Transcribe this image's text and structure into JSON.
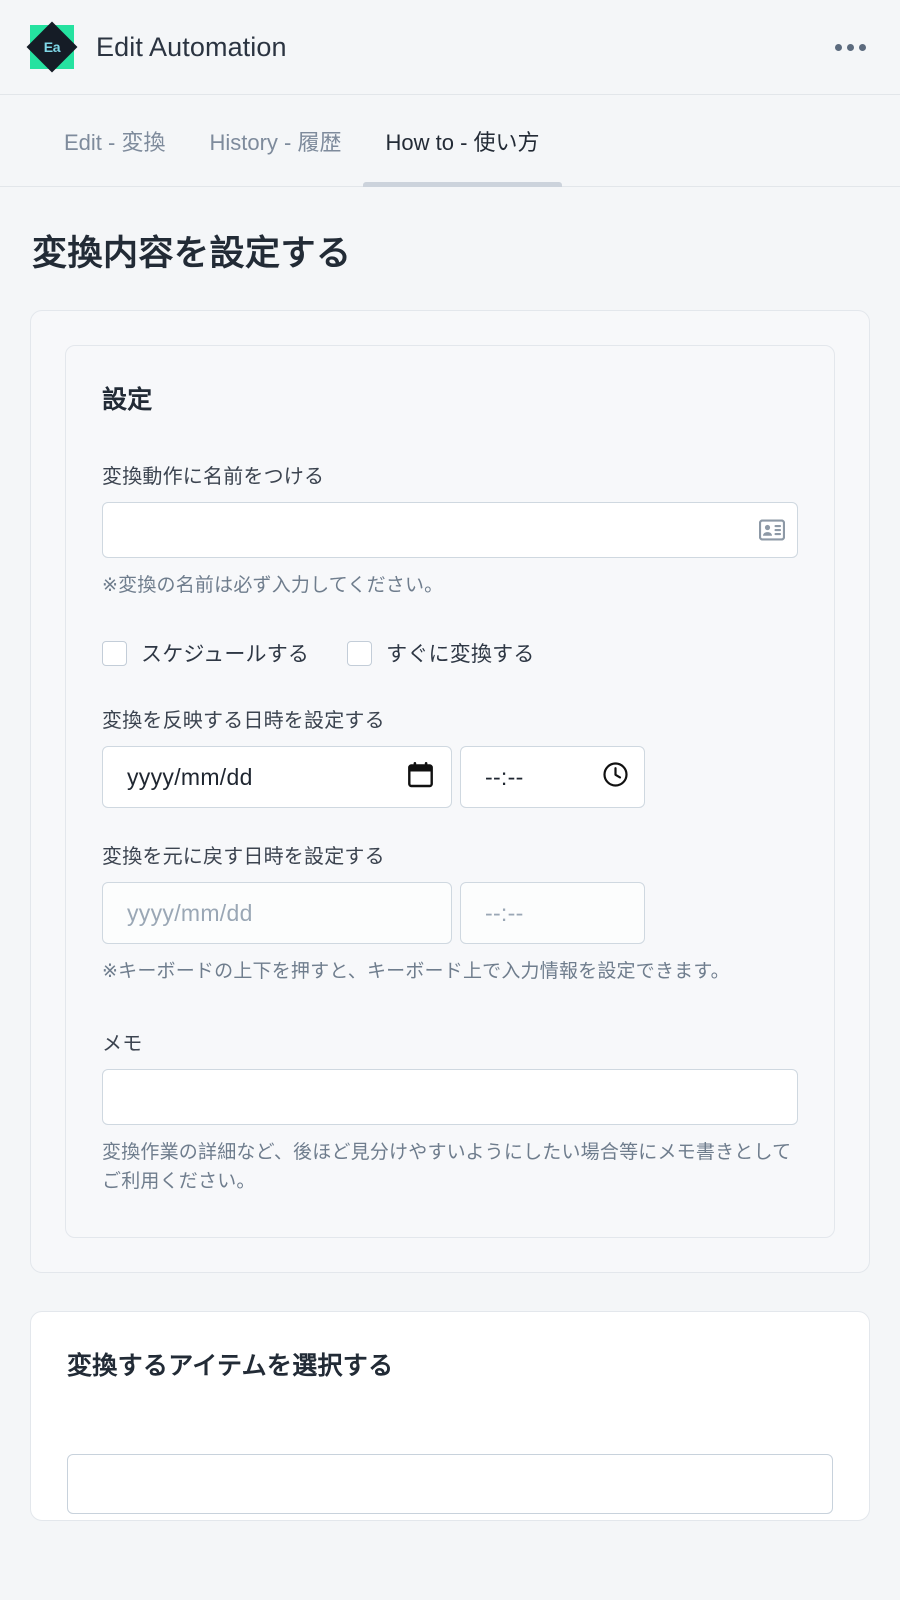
{
  "header": {
    "logo_text": "Ea",
    "logo_icon": "diamond-logo-icon",
    "title": "Edit Automation",
    "overflow_icon": "more-horizontal-icon",
    "brand_color": "#25e2a0"
  },
  "tabs": [
    {
      "label": "Edit - 変換",
      "active": false
    },
    {
      "label": "History - 履歴",
      "active": false
    },
    {
      "label": "How to - 使い方",
      "active": true
    }
  ],
  "page": {
    "title": "変換内容を設定する"
  },
  "settings_card": {
    "heading": "設定",
    "name_field": {
      "label": "変換動作に名前をつける",
      "value": "",
      "placeholder": "",
      "icon": "contact-card-icon",
      "helper": "※変換の名前は必ず入力してください。"
    },
    "checkboxes": [
      {
        "label": "スケジュールする",
        "checked": false
      },
      {
        "label": "すぐに変換する",
        "checked": false
      }
    ],
    "apply_datetime": {
      "label": "変換を反映する日時を設定する",
      "date_value": "yyyy/mm/dd",
      "date_icon": "calendar-icon",
      "time_value": "--:--",
      "time_icon": "clock-icon",
      "enabled": true
    },
    "revert_datetime": {
      "label": "変換を元に戻す日時を設定する",
      "date_value": "yyyy/mm/dd",
      "time_value": "--:--",
      "enabled": false
    },
    "keyboard_helper": "※キーボードの上下を押すと、キーボード上で入力情報を設定できます。",
    "memo": {
      "label": "メモ",
      "value": "",
      "placeholder": "",
      "helper": "変換作業の詳細など、後ほど見分けやすいようにしたい場合等にメモ書きとしてご利用ください。"
    }
  },
  "items_card": {
    "heading": "変換するアイテムを選択する"
  }
}
